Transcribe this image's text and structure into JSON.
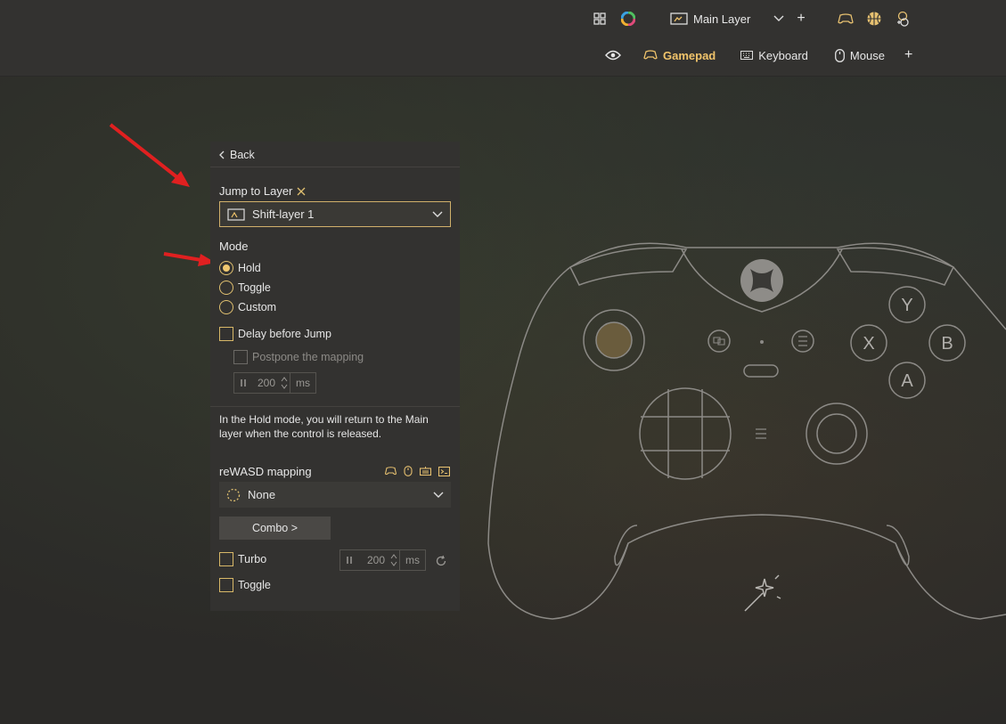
{
  "topbar": {
    "layer_label": "Main Layer",
    "add_symbol": "+",
    "tabs": [
      {
        "label": "Gamepad",
        "active": true
      },
      {
        "label": "Keyboard",
        "active": false
      },
      {
        "label": "Mouse",
        "active": false
      }
    ]
  },
  "panel": {
    "back_label": "Back",
    "jump_label": "Jump to Layer",
    "jump_value": "Shift-layer 1",
    "mode_label": "Mode",
    "modes": [
      {
        "label": "Hold",
        "selected": true
      },
      {
        "label": "Toggle",
        "selected": false
      },
      {
        "label": "Custom",
        "selected": false
      }
    ],
    "delay_label": "Delay before Jump",
    "postpone_label": "Postpone the mapping",
    "delay_value": "200",
    "unit": "ms",
    "description": "In the Hold mode, you will return to the Main layer when the control is released.",
    "mapping_label": "reWASD mapping",
    "mapping_value": "None",
    "combo_label": "Combo >",
    "turbo_label": "Turbo",
    "turbo_value": "200",
    "toggle_label": "Toggle"
  },
  "controller": {
    "buttons": {
      "y": "Y",
      "x": "X",
      "b": "B",
      "a": "A"
    }
  },
  "colors": {
    "accent": "#f1c46b",
    "arrow": "#e02020"
  }
}
